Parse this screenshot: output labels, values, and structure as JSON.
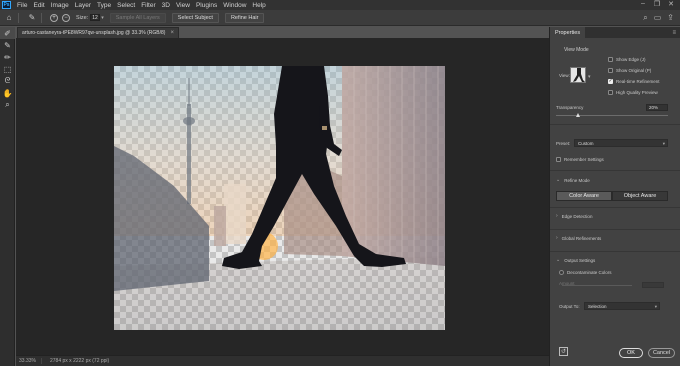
{
  "menubar": {
    "logo": "Ps",
    "items": [
      "File",
      "Edit",
      "Image",
      "Layer",
      "Type",
      "Select",
      "Filter",
      "3D",
      "View",
      "Plugins",
      "Window",
      "Help"
    ],
    "window_controls": [
      "–",
      "❐",
      "✕"
    ]
  },
  "options": {
    "size_label": "Size:",
    "size_value": "12",
    "sample_all_layers": "Sample All Layers",
    "select_subject": "Select Subject",
    "refine_hair": "Refine Hair"
  },
  "document": {
    "tab_title": "arturo-castaneyra-tPE8WR97qw-unsplash.jpg @ 33.3% (RGB/8)",
    "close_glyph": "×"
  },
  "status": {
    "zoom": "33.33%",
    "doc_info": "2784 px x 2222 px (72 ppi)"
  },
  "properties": {
    "tab": "Properties",
    "view_mode_title": "View Mode",
    "view_label": "View:",
    "show_edge": "Show Edge (J)",
    "show_original": "Show Original (P)",
    "realtime_refinement": "Real-time Refinement",
    "high_quality_preview": "High Quality Preview",
    "transparency_label": "Transparency",
    "transparency_value": "20%",
    "transparency_level": 0.2,
    "preset_label": "Preset:",
    "preset_value": "Custom",
    "remember_settings": "Remember Settings",
    "refine_mode": "Refine Mode",
    "color_aware": "Color Aware",
    "object_aware": "Object Aware",
    "edge_detection": "Edge Detection",
    "global_refinements": "Global Refinements",
    "output_settings": "Output Settings",
    "decontaminate_colors": "Decontaminate Colors",
    "amount_label": "Amount",
    "output_to_label": "Output To:",
    "output_to_value": "Selection",
    "ok": "OK",
    "cancel": "Cancel"
  }
}
